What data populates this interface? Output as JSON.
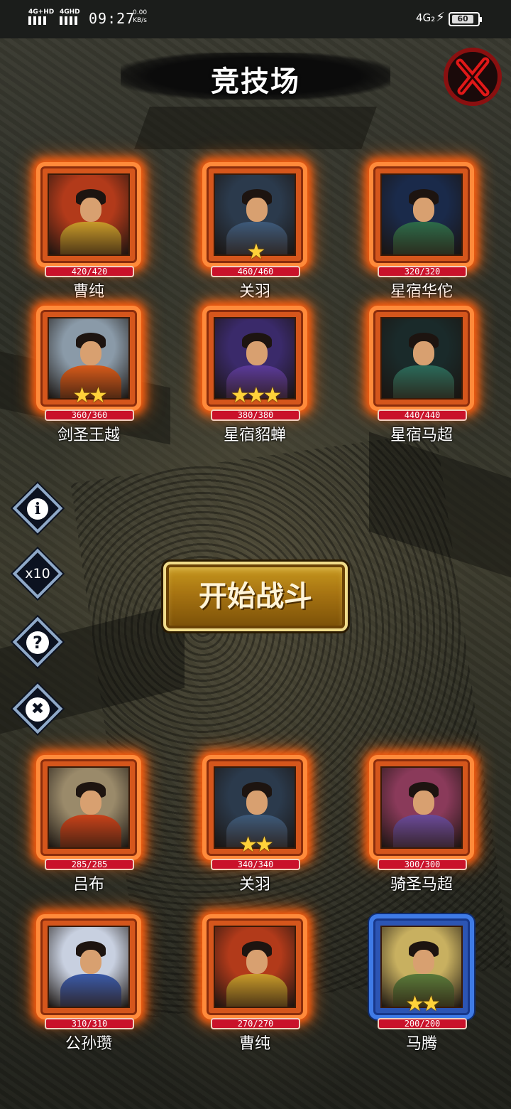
{
  "status_bar": {
    "sim1": "4G+HD",
    "sim2": "4GHD",
    "time": "09:27",
    "speed_value": "0.00",
    "speed_unit": "KB/s",
    "network": "4G₂",
    "battery": "60"
  },
  "header": {
    "title": "竞技场",
    "close_icon": "red-x-close-icon"
  },
  "enemy_team": [
    {
      "name": "曹纯",
      "hp": "420/420",
      "stars": 0,
      "frame": "orange",
      "colors": [
        "#c89a2a",
        "#b23a1a"
      ]
    },
    {
      "name": "关羽",
      "hp": "460/460",
      "stars": 1,
      "frame": "orange",
      "colors": [
        "#3d5a7a",
        "#2b3a4c"
      ]
    },
    {
      "name": "星宿华佗",
      "hp": "320/320",
      "stars": 0,
      "frame": "orange",
      "colors": [
        "#2c6b4a",
        "#1a2a4a"
      ]
    },
    {
      "name": "剑圣王越",
      "hp": "360/360",
      "stars": 2,
      "frame": "orange",
      "colors": [
        "#d65a1a",
        "#8a9aa8"
      ]
    },
    {
      "name": "星宿貂蝉",
      "hp": "380/380",
      "stars": 3,
      "frame": "orange",
      "colors": [
        "#5a3a9a",
        "#3a2a6a"
      ]
    },
    {
      "name": "星宿马超",
      "hp": "440/440",
      "stars": 0,
      "frame": "orange",
      "colors": [
        "#2a6a5a",
        "#1a2a2a"
      ]
    }
  ],
  "side_buttons": [
    {
      "name": "info-button",
      "icon": "info-icon",
      "label": "i"
    },
    {
      "name": "speed-x10-button",
      "icon": "speed-icon",
      "label": "x10"
    },
    {
      "name": "help-button",
      "icon": "question-icon",
      "label": "?"
    },
    {
      "name": "quit-button",
      "icon": "close-icon",
      "label": "✖"
    }
  ],
  "start_button": {
    "label": "开始战斗"
  },
  "player_team": [
    {
      "name": "吕布",
      "hp": "285/285",
      "stars": 0,
      "frame": "orange",
      "colors": [
        "#c8421a",
        "#9a8a6a"
      ]
    },
    {
      "name": "关羽",
      "hp": "340/340",
      "stars": 2,
      "frame": "orange",
      "colors": [
        "#3d5a7a",
        "#2b3a4c"
      ]
    },
    {
      "name": "骑圣马超",
      "hp": "300/300",
      "stars": 0,
      "frame": "orange",
      "colors": [
        "#6a4a9a",
        "#8a3a5a"
      ]
    },
    {
      "name": "公孙瓒",
      "hp": "310/310",
      "stars": 0,
      "frame": "orange",
      "colors": [
        "#3a5aa8",
        "#c8d0e0"
      ]
    },
    {
      "name": "曹纯",
      "hp": "270/270",
      "stars": 0,
      "frame": "orange",
      "colors": [
        "#c89a2a",
        "#b23a1a"
      ]
    },
    {
      "name": "马腾",
      "hp": "200/200",
      "stars": 2,
      "frame": "blue",
      "colors": [
        "#5a7a3a",
        "#c8b060"
      ]
    }
  ]
}
